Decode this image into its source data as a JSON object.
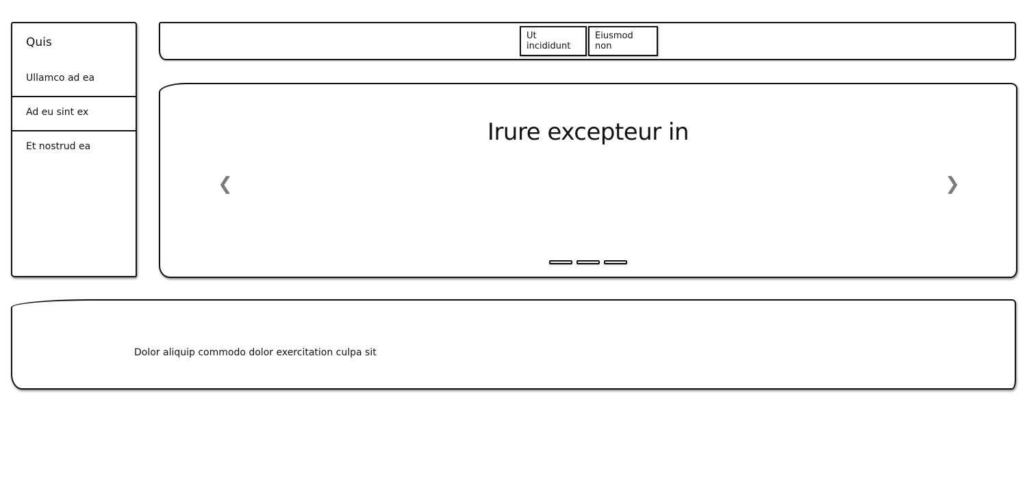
{
  "sidebar": {
    "title": "Quis",
    "items": [
      {
        "label": "Ullamco ad ea"
      },
      {
        "label": "Ad eu sint ex"
      },
      {
        "label": "Et nostrud ea"
      }
    ]
  },
  "topbar": {
    "buttons": [
      {
        "label": "Ut incididunt"
      },
      {
        "label": "Eiusmod non"
      }
    ]
  },
  "carousel": {
    "heading": "Irure excepteur in",
    "prev_icon": "chevron-left-icon",
    "next_icon": "chevron-right-icon",
    "prev_glyph": "❮",
    "next_glyph": "❯",
    "slide_count": 3
  },
  "footer": {
    "text": "Dolor aliquip commodo dolor exercitation culpa sit"
  },
  "colors": {
    "ink": "#111111",
    "arrow": "#7a7a7a",
    "background": "#ffffff"
  }
}
